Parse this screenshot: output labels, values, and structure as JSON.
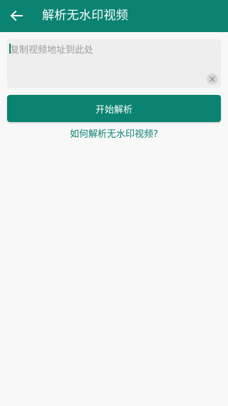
{
  "header": {
    "title": "解析无水印视频",
    "back_icon": "arrow-left-icon",
    "background_color": "#0a8372"
  },
  "url_input": {
    "value": "",
    "placeholder": "复制视频地址到此处",
    "clear_icon": "close-icon"
  },
  "actions": {
    "parse_label": "开始解析",
    "help_link_label": "如何解析无水印视频?"
  },
  "colors": {
    "accent": "#0a8372",
    "page_background": "#f8f8f8",
    "input_background": "#eeeeee",
    "placeholder_text": "#9e9e9e"
  }
}
